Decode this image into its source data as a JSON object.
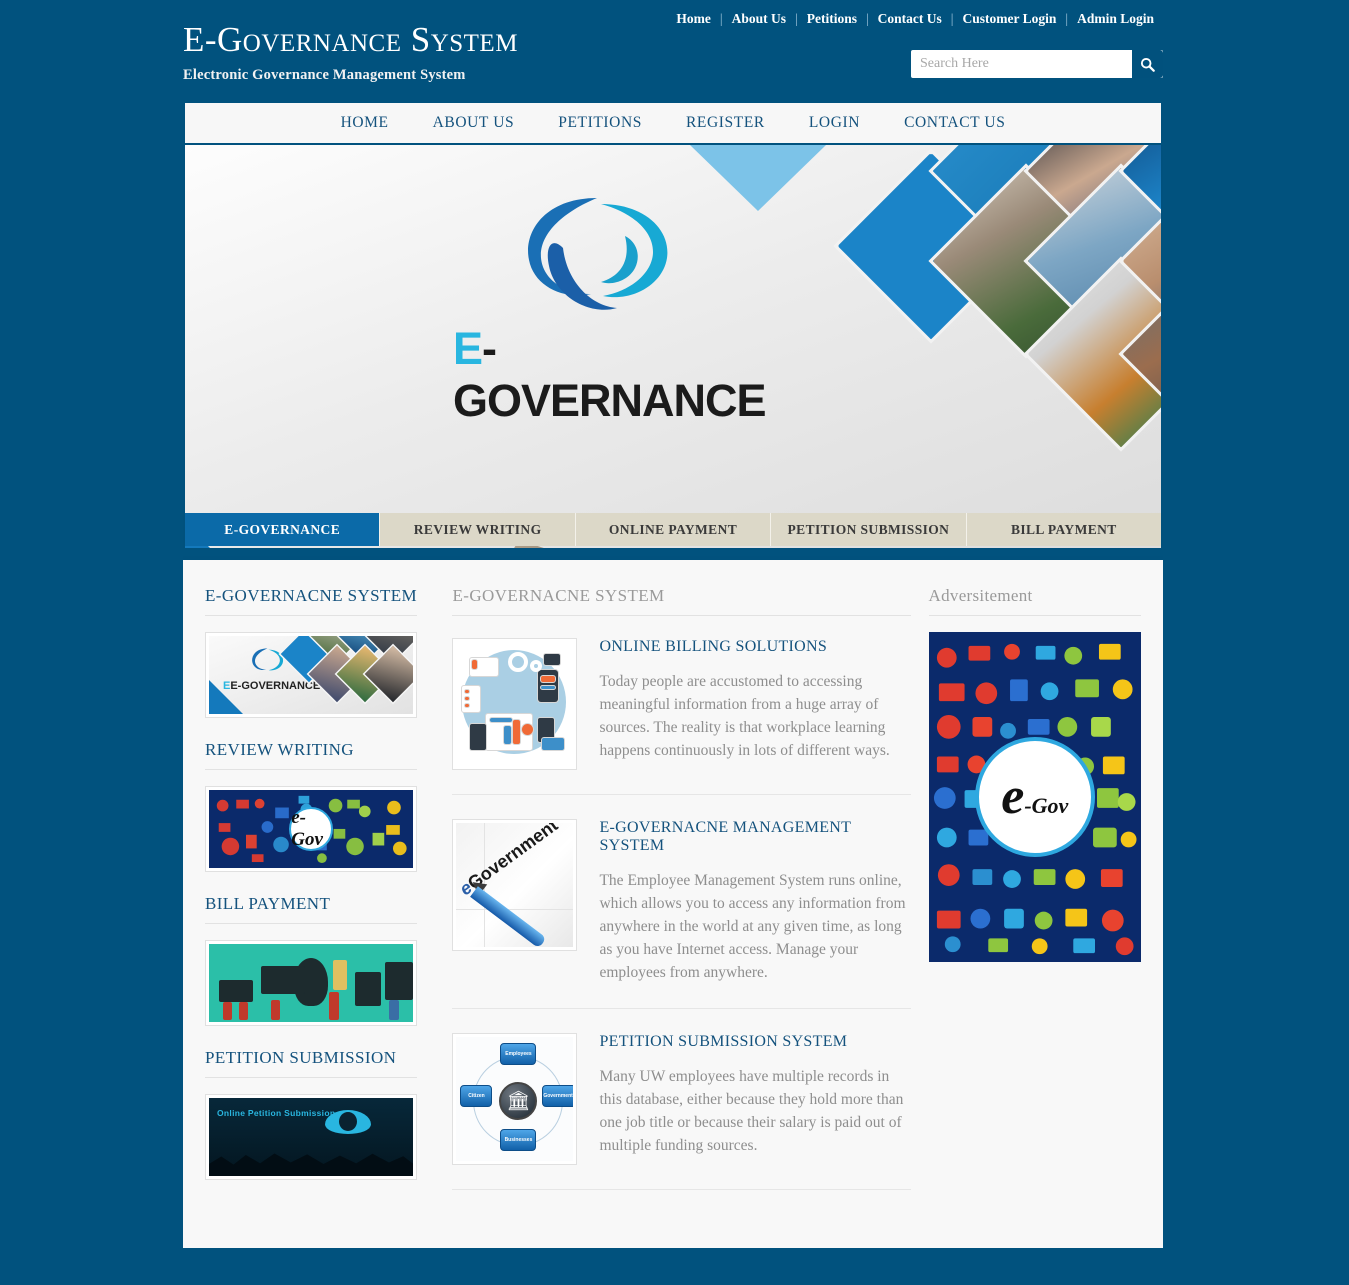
{
  "site": {
    "title": "E-Governance System",
    "subtitle": "Electronic Governance Management System"
  },
  "topnav": {
    "items": [
      {
        "label": "Home"
      },
      {
        "label": "About Us"
      },
      {
        "label": "Petitions"
      },
      {
        "label": "Contact Us"
      },
      {
        "label": "Customer Login"
      },
      {
        "label": "Admin Login"
      }
    ],
    "separator": "|"
  },
  "search": {
    "placeholder": "Search Here",
    "value": "",
    "icon": "search-icon"
  },
  "mainmenu": {
    "items": [
      {
        "label": "HOME"
      },
      {
        "label": "ABOUT US"
      },
      {
        "label": "PETITIONS"
      },
      {
        "label": "REGISTER"
      },
      {
        "label": "LOGIN"
      },
      {
        "label": "CONTACT US"
      }
    ]
  },
  "hero": {
    "wordmark_e": "E",
    "wordmark_rest": "-GOVERNANCE"
  },
  "slider_tabs": [
    {
      "label": "E-GOVERNANCE",
      "active": true
    },
    {
      "label": "REVIEW WRITING",
      "active": false
    },
    {
      "label": "ONLINE PAYMENT",
      "active": false
    },
    {
      "label": "PETITION SUBMISSION",
      "active": false
    },
    {
      "label": "BILL PAYMENT",
      "active": false
    }
  ],
  "sidebar": {
    "sections": [
      {
        "heading": "E-GOVERNACNE SYSTEM",
        "thumb": "egovernance-banner-thumbnail",
        "caption": "E-GOVERNANCE"
      },
      {
        "heading": "REVIEW WRITING",
        "thumb": "egov-icons-thumbnail",
        "caption": "e-Gov"
      },
      {
        "heading": "BILL PAYMENT",
        "thumb": "digital-devices-thumbnail",
        "caption": ""
      },
      {
        "heading": "PETITION SUBMISSION",
        "thumb": "online-petition-thumbnail",
        "caption": "Online Petition Submission"
      }
    ]
  },
  "main": {
    "heading": "E-GOVERNACNE SYSTEM",
    "items": [
      {
        "title": "ONLINE BILLING SOLUTIONS",
        "text": "Today people are accustomed to accessing meaningful information from a huge array of sources. The reality is that workplace learning happens continuously in lots of different ways.",
        "thumb": "online-billing-illustration"
      },
      {
        "title": "E-GOVERNACNE MANAGEMENT SYSTEM",
        "text": "The Employee Management System runs online, which allows you to access any information from anywhere in the world at any given time, as long as you have Internet access. Manage your employees from anywhere.",
        "thumb": "egovernment-pen-illustration",
        "thumb_word_e": "e",
        "thumb_word_rest": "Government"
      },
      {
        "title": "PETITION SUBMISSION SYSTEM",
        "text": "Many UW employees have multiple records in this database, either because they hold more than one job title or because their salary is paid out of multiple funding sources.",
        "thumb": "petition-diagram-illustration",
        "diagram_nodes": [
          "Employees",
          "Citizen",
          "Governments",
          "Businesses"
        ]
      }
    ]
  },
  "advertisement": {
    "heading": "Adversitement",
    "badge_main": "e",
    "badge_sub": "-Gov",
    "image": "egov-social-icons-advertisement"
  },
  "colors": {
    "page_background": "#01527e",
    "brand_dark_blue": "#14527d",
    "accent_cyan": "#29b6e0",
    "tab_active": "#0b6aa8",
    "tab_inactive": "#dcd8c8",
    "panel_background": "#f8f8f8",
    "body_text": "#8e8e8e"
  }
}
